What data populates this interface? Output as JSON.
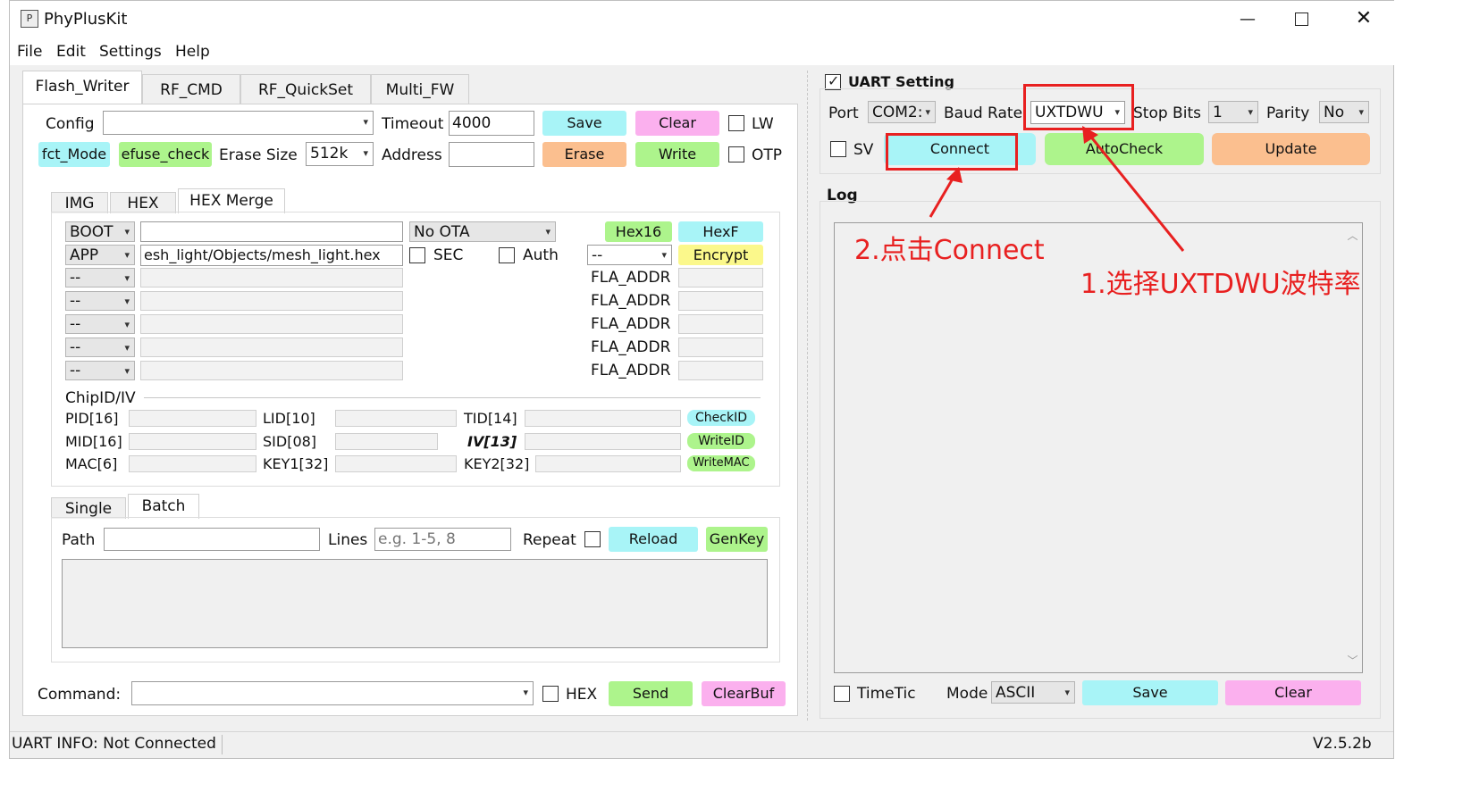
{
  "window": {
    "title": "PhyPlusKit"
  },
  "menu": [
    "File",
    "Edit",
    "Settings",
    "Help"
  ],
  "tabs": [
    "Flash_Writer",
    "RF_CMD",
    "RF_QuickSet",
    "Multi_FW"
  ],
  "flash": {
    "config_label": "Config",
    "config_value": "",
    "timeout_label": "Timeout",
    "timeout_value": "4000",
    "save": "Save",
    "clear": "Clear",
    "lw": "LW",
    "fct_mode": "fct_Mode",
    "efuse_check": "efuse_check",
    "erase_size_label": "Erase Size",
    "erase_size_value": "512k",
    "address_label": "Address",
    "address_value": "",
    "erase": "Erase",
    "write": "Write",
    "otp": "OTP"
  },
  "subtabs": [
    "IMG",
    "HEX",
    "HEX Merge"
  ],
  "hexmerge": {
    "boot": "BOOT",
    "boot_path": "",
    "no_ota": "No OTA",
    "hex16": "Hex16",
    "hexf": "HexF",
    "app": "APP",
    "app_path": "esh_light/Objects/mesh_light.hex",
    "sec": "SEC",
    "auth": "Auth",
    "enc_sel": "--",
    "encrypt": "Encrypt",
    "rows": [
      "--",
      "--",
      "--",
      "--",
      "--"
    ],
    "fla_addr": "FLA_ADDR"
  },
  "chipid": {
    "title": "ChipID/IV",
    "pid": "PID[16]",
    "lid": "LID[10]",
    "tid": "TID[14]",
    "checkid": "CheckID",
    "mid": "MID[16]",
    "sid": "SID[08]",
    "iv": "IV[13]",
    "writeid": "WriteID",
    "mac": "MAC[6]",
    "key1": "KEY1[32]",
    "key2": "KEY2[32]",
    "writemac": "WriteMAC"
  },
  "batch_tabs": [
    "Single",
    "Batch"
  ],
  "batch": {
    "path_label": "Path",
    "path_value": "",
    "lines_label": "Lines",
    "lines_placeholder": "e.g. 1-5, 8",
    "repeat": "Repeat",
    "reload": "Reload",
    "genkey": "GenKey"
  },
  "command": {
    "label": "Command:",
    "value": "",
    "hex": "HEX",
    "send": "Send",
    "clearbuf": "ClearBuf"
  },
  "uart": {
    "title": "UART Setting",
    "port_label": "Port",
    "port_value": "COM2:",
    "baud_label": "Baud Rate",
    "baud_value": "UXTDWU",
    "stop_label": "Stop Bits",
    "stop_value": "1",
    "parity_label": "Parity",
    "parity_value": "No",
    "sv": "SV",
    "connect": "Connect",
    "autocheck": "AutoCheck",
    "update": "Update"
  },
  "log": {
    "title": "Log",
    "timetic": "TimeTic",
    "mode_label": "Mode",
    "mode_value": "ASCII",
    "save": "Save",
    "clear": "Clear"
  },
  "annotations": {
    "step1": "1.选择UXTDWU波特率",
    "step2": "2.点击Connect"
  },
  "status": {
    "uart_info": "UART INFO: Not Connected",
    "version": "V2.5.2b"
  },
  "colors": {
    "cyan": "#a8f4f7",
    "pink": "#fbb0ee",
    "orange": "#fbbf8f",
    "green": "#adf48c",
    "yellow": "#fbf88b",
    "annotation_red": "#e82020"
  }
}
